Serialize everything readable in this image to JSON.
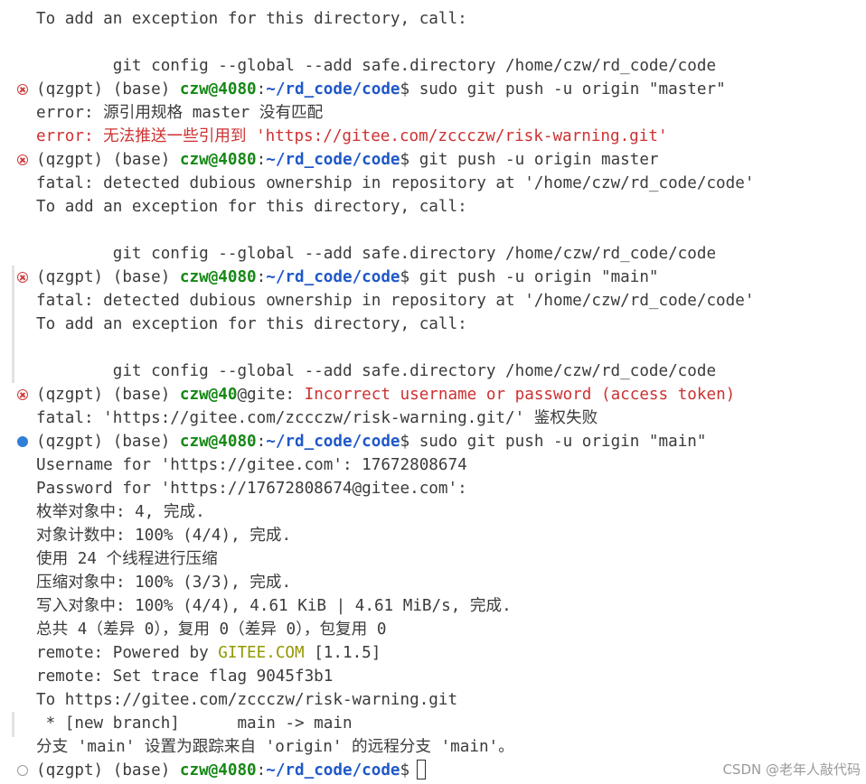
{
  "lines": [
    {
      "text": "To add an exception for this directory, call:"
    },
    {
      "text": "        git config --global --add safe.directory /home/czw/rd_code/code"
    },
    {
      "prompt_prefix": "(qzgpt) (base) ",
      "user": "czw@4080",
      "colon": ":",
      "path": "~/rd_code/code",
      "command": "$ sudo git push -u origin \"master\""
    },
    {
      "text": "error: 源引用规格 master 没有匹配"
    },
    {
      "text": "error: 无法推送一些引用到 'https://gitee.com/zccczw/risk-warning.git'"
    },
    {
      "prompt_prefix": "(qzgpt) (base) ",
      "user": "czw@4080",
      "colon": ":",
      "path": "~/rd_code/code",
      "command": "$ git push -u origin master"
    },
    {
      "text": "fatal: detected dubious ownership in repository at '/home/czw/rd_code/code'"
    },
    {
      "text": "To add an exception for this directory, call:"
    },
    {
      "text": "        git config --global --add safe.directory /home/czw/rd_code/code"
    },
    {
      "prompt_prefix": "(qzgpt) (base) ",
      "user": "czw@4080",
      "colon": ":",
      "path": "~/rd_code/code",
      "command": "$ git push -u origin \"main\""
    },
    {
      "text": "fatal: detected dubious ownership in repository at '/home/czw/rd_code/code'"
    },
    {
      "text": "To add an exception for this directory, call:"
    },
    {
      "text": "        git config --global --add safe.directory /home/czw/rd_code/code"
    },
    {
      "prompt_prefix": "(qzgpt) (base) ",
      "user": "czw@40",
      "rest": "@gite: ",
      "error_text": "Incorrect username or password (access token)"
    },
    {
      "text": "fatal: 'https://gitee.com/zccczw/risk-warning.git/' 鉴权失败"
    },
    {
      "prompt_prefix": "(qzgpt) (base) ",
      "user": "czw@4080",
      "colon": ":",
      "path": "~/rd_code/code",
      "command": "$ sudo git push -u origin \"main\""
    },
    {
      "text": "Username for 'https://gitee.com': 17672808674"
    },
    {
      "text": "Password for 'https://17672808674@gitee.com':"
    },
    {
      "text": "枚举对象中: 4, 完成."
    },
    {
      "text": "对象计数中: 100% (4/4), 完成."
    },
    {
      "text": "使用 24 个线程进行压缩"
    },
    {
      "text": "压缩对象中: 100% (3/3), 完成."
    },
    {
      "text": "写入对象中: 100% (4/4), 4.61 KiB | 4.61 MiB/s, 完成."
    },
    {
      "text": "总共 4（差异 0），复用 0（差异 0），包复用 0"
    },
    {
      "prefix": "remote: Powered by ",
      "brand": "GITEE.COM",
      "suffix": " [1.1.5]"
    },
    {
      "text": "remote: Set trace flag 9045f3b1"
    },
    {
      "text": "To https://gitee.com/zccczw/risk-warning.git"
    },
    {
      "text": " * [new branch]      main -> main"
    },
    {
      "text": "分支 'main' 设置为跟踪来自 'origin' 的远程分支 'main'。"
    },
    {
      "prompt_prefix": "(qzgpt) (base) ",
      "user": "czw@4080",
      "colon": ":",
      "path": "~/rd_code/code",
      "command": "$"
    }
  ],
  "watermark": "CSDN @老年人敲代码",
  "colors": {
    "user": "#168816",
    "path": "#1f58c8",
    "error": "#cd3131",
    "brand": "#949800",
    "error_marker": "#d23a3a",
    "success_marker": "#2f7fd6"
  }
}
